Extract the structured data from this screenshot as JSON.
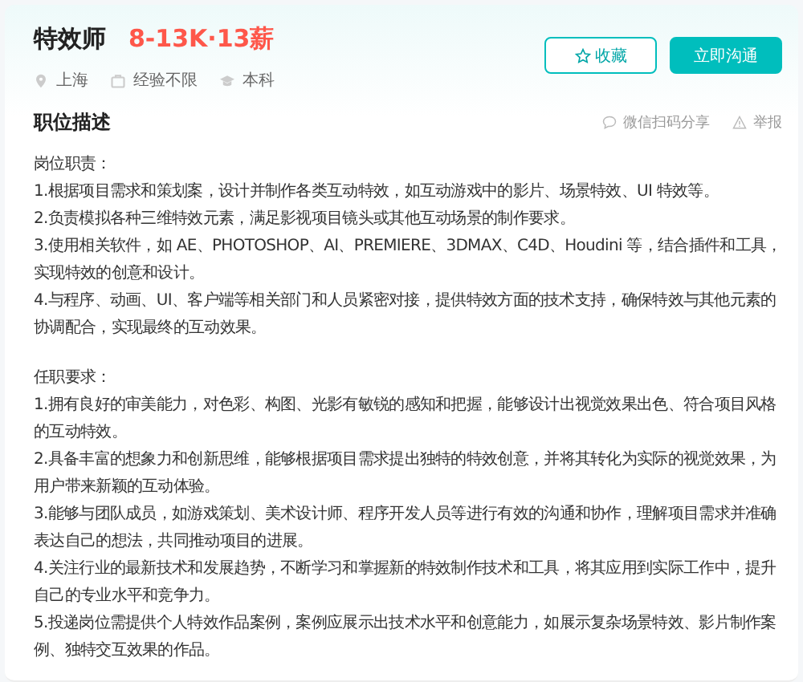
{
  "job": {
    "title": "特效师",
    "salary": "8-13K·13薪",
    "meta": [
      {
        "kind": "location",
        "text": "上海"
      },
      {
        "kind": "experience",
        "text": "经验不限"
      },
      {
        "kind": "degree",
        "text": "本科"
      }
    ]
  },
  "actions": [
    {
      "kind": "favorite",
      "label": "收藏"
    },
    {
      "kind": "primary",
      "label": "立即沟通"
    }
  ],
  "section": {
    "title": "职位描述",
    "links": [
      {
        "kind": "share",
        "label": "微信扫码分享"
      },
      {
        "kind": "report",
        "label": "举报"
      }
    ]
  },
  "description": [
    {
      "heading": "岗位职责：",
      "items": [
        "1.根据项目需求和策划案，设计并制作各类互动特效，如互动游戏中的影片、场景特效、UI 特效等。",
        "2.负责模拟各种三维特效元素，满足影视项目镜头或其他互动场景的制作要求。",
        "3.使用相关软件，如 AE、PHOTOSHOP、AI、PREMIERE、3DMAX、C4D、Houdini 等，结合插件和工具，实现特效的创意和设计。",
        "4.与程序、动画、UI、客户端等相关部门和人员紧密对接，提供特效方面的技术支持，确保特效与其他元素的协调配合，实现最终的互动效果。"
      ]
    },
    {
      "heading": "任职要求：",
      "items": [
        "1.拥有良好的审美能力，对色彩、构图、光影有敏锐的感知和把握，能够设计出视觉效果出色、符合项目风格的互动特效。",
        "2.具备丰富的想象力和创新思维，能够根据项目需求提出独特的特效创意，并将其转化为实际的视觉效果，为用户带来新颖的互动体验。",
        "3.能够与团队成员，如游戏策划、美术设计师、程序开发人员等进行有效的沟通和协作，理解项目需求并准确表达自己的想法，共同推动项目的进展。",
        "4.关注行业的最新技术和发展趋势，不断学习和掌握新的特效制作技术和工具，将其应用到实际工作中，提升自己的专业水平和竞争力。",
        "5.投递岗位需提供个人特效作品案例，案例应展示出技术水平和创意能力，如展示复杂场景特效、影片制作案例、独特交互效果的作品。"
      ]
    }
  ]
}
